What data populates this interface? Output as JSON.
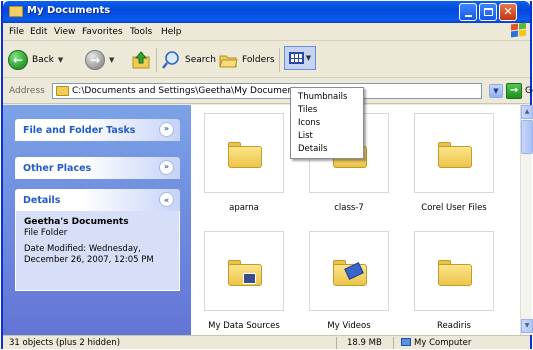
{
  "window": {
    "title": "My Documents"
  },
  "menubar": {
    "items": [
      "File",
      "Edit",
      "View",
      "Favorites",
      "Tools",
      "Help"
    ]
  },
  "toolbar": {
    "back_label": "Back",
    "search_label": "Search",
    "folders_label": "Folders"
  },
  "views_menu": {
    "items": [
      "Thumbnails",
      "Tiles",
      "Icons",
      "List",
      "Details"
    ]
  },
  "address": {
    "label": "Address",
    "path": "C:\\Documents and Settings\\Geetha\\My Documents",
    "go_label": "Go"
  },
  "taskpane": {
    "panels": [
      {
        "title": "File and Folder Tasks",
        "state": "collapsed"
      },
      {
        "title": "Other Places",
        "state": "collapsed"
      },
      {
        "title": "Details",
        "state": "expanded"
      }
    ],
    "details": {
      "name": "Geetha's Documents",
      "type": "File Folder",
      "date": "Date Modified: Wednesday, December 26, 2007, 12:05 PM"
    }
  },
  "items": [
    {
      "name": "aparna",
      "icon": "folder-icon"
    },
    {
      "name": "class-7",
      "icon": "folder-icon"
    },
    {
      "name": "Corel User Files",
      "icon": "folder-icon"
    },
    {
      "name": "My Data Sources",
      "icon": "data-sources-folder-icon"
    },
    {
      "name": "My Videos",
      "icon": "videos-folder-icon"
    },
    {
      "name": "Readiris",
      "icon": "folder-icon"
    }
  ],
  "statusbar": {
    "objects": "31 objects (plus 2 hidden)",
    "size": "18.9 MB",
    "location": "My Computer"
  },
  "colors": {
    "titlebar": "#0a5cf0",
    "taskpane": "#7ba2e7",
    "panel_title": "#215dc6",
    "folder": "#ecc44a"
  }
}
